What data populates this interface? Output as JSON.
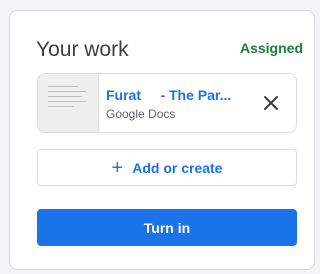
{
  "card": {
    "title": "Your work",
    "status": "Assigned",
    "status_color": "#188038"
  },
  "attachment": {
    "title": "Furat     - The Par...",
    "type": "Google Docs",
    "thumbnail_icon": "document-thumbnail",
    "remove_icon": "close-icon"
  },
  "actions": {
    "add_icon": "plus-icon",
    "add_label": "Add or create",
    "turn_in_label": "Turn in",
    "accent_color": "#1a73e8"
  }
}
